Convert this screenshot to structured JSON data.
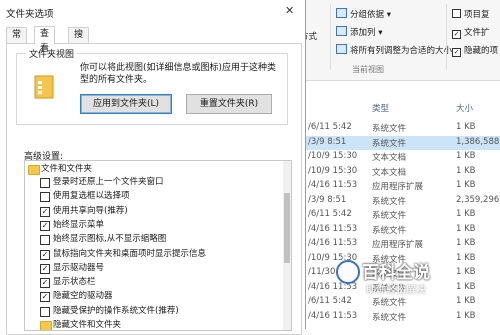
{
  "dialog": {
    "title": "文件夹选项",
    "tabs": [
      "常规",
      "查看",
      "搜索"
    ],
    "active_tab": "查看",
    "folder_views": {
      "legend": "文件夹视图",
      "description": "你可以将此视图(如详细信息或图标)应用于这种类型的所有文件夹。",
      "apply_button": "应用到文件夹(L)",
      "reset_button": "重置文件夹(R)"
    },
    "advanced": {
      "label": "高级设置:",
      "root": "文件和文件夹",
      "items": [
        {
          "label": "登录时还原上一个文件夹窗口",
          "checked": false
        },
        {
          "label": "使用复选框以选择项",
          "checked": false
        },
        {
          "label": "使用共享向导(推荐)",
          "checked": true
        },
        {
          "label": "始终显示菜单",
          "checked": true
        },
        {
          "label": "始终显示图标,从不显示缩略图",
          "checked": false
        },
        {
          "label": "鼠标指向文件夹和桌面项时显示提示信息",
          "checked": true
        },
        {
          "label": "显示驱动器号",
          "checked": true
        },
        {
          "label": "显示状态栏",
          "checked": true
        },
        {
          "label": "隐藏空的驱动器",
          "checked": true
        },
        {
          "label": "隐藏受保护的操作系统文件(推荐)",
          "checked": false
        }
      ],
      "last_folder": "隐藏文件和文件夹"
    }
  },
  "explorer": {
    "ribbon": {
      "group_by": "分组依据",
      "add_column": "添加列",
      "fit_columns": "将所有列调整为合适的大小",
      "current_view": "当前视图",
      "layout_fragment": "方式",
      "item_checkbox": "项目复",
      "file_ext": "文件扩",
      "hidden_items": "隐藏的项",
      "item_checkbox_checked": false,
      "file_ext_checked": true,
      "hidden_items_checked": true
    },
    "columns": {
      "type": "类型",
      "size": "大小"
    },
    "rows": [
      {
        "date": "/6/11 5:42",
        "type": "系统文件",
        "size": "1 KB"
      },
      {
        "date": "/3/9 8:51",
        "type": "系统文件",
        "size": "1,386,588..."
      },
      {
        "date": "/10/9 15:30",
        "type": "文本文档",
        "size": "1 KB"
      },
      {
        "date": "/10/9 15:30",
        "type": "文本文档",
        "size": "1 KB"
      },
      {
        "date": "/4/16 11:53",
        "type": "应用程序扩展",
        "size": "1 KB"
      },
      {
        "date": "/3/9 8:51",
        "type": "系统文件",
        "size": "2,359,296..."
      },
      {
        "date": "/6/11 5:42",
        "type": "系统文件",
        "size": "1 KB"
      },
      {
        "date": "/4/16 11:53",
        "type": "系统文件",
        "size": "1 KB"
      },
      {
        "date": "/4/16 11:53",
        "type": "应用程序扩展",
        "size": "1 KB"
      },
      {
        "date": "/10/9 15:30",
        "type": "系统文件",
        "size": "1 KB"
      },
      {
        "date": "/11/30 9:28",
        "type": "系统文件",
        "size": "1 KB"
      },
      {
        "date": "/4/16 11:53",
        "type": "系统文件",
        "size": "1 KB"
      },
      {
        "date": "/6/11 5:42",
        "type": "系统文件",
        "size": "1 KB"
      },
      {
        "date": "/4/16 11:53",
        "type": "系统文件",
        "size": "1 KB"
      }
    ]
  },
  "watermark": {
    "title": "百科全说",
    "subtitle": "助你轻松解决"
  }
}
